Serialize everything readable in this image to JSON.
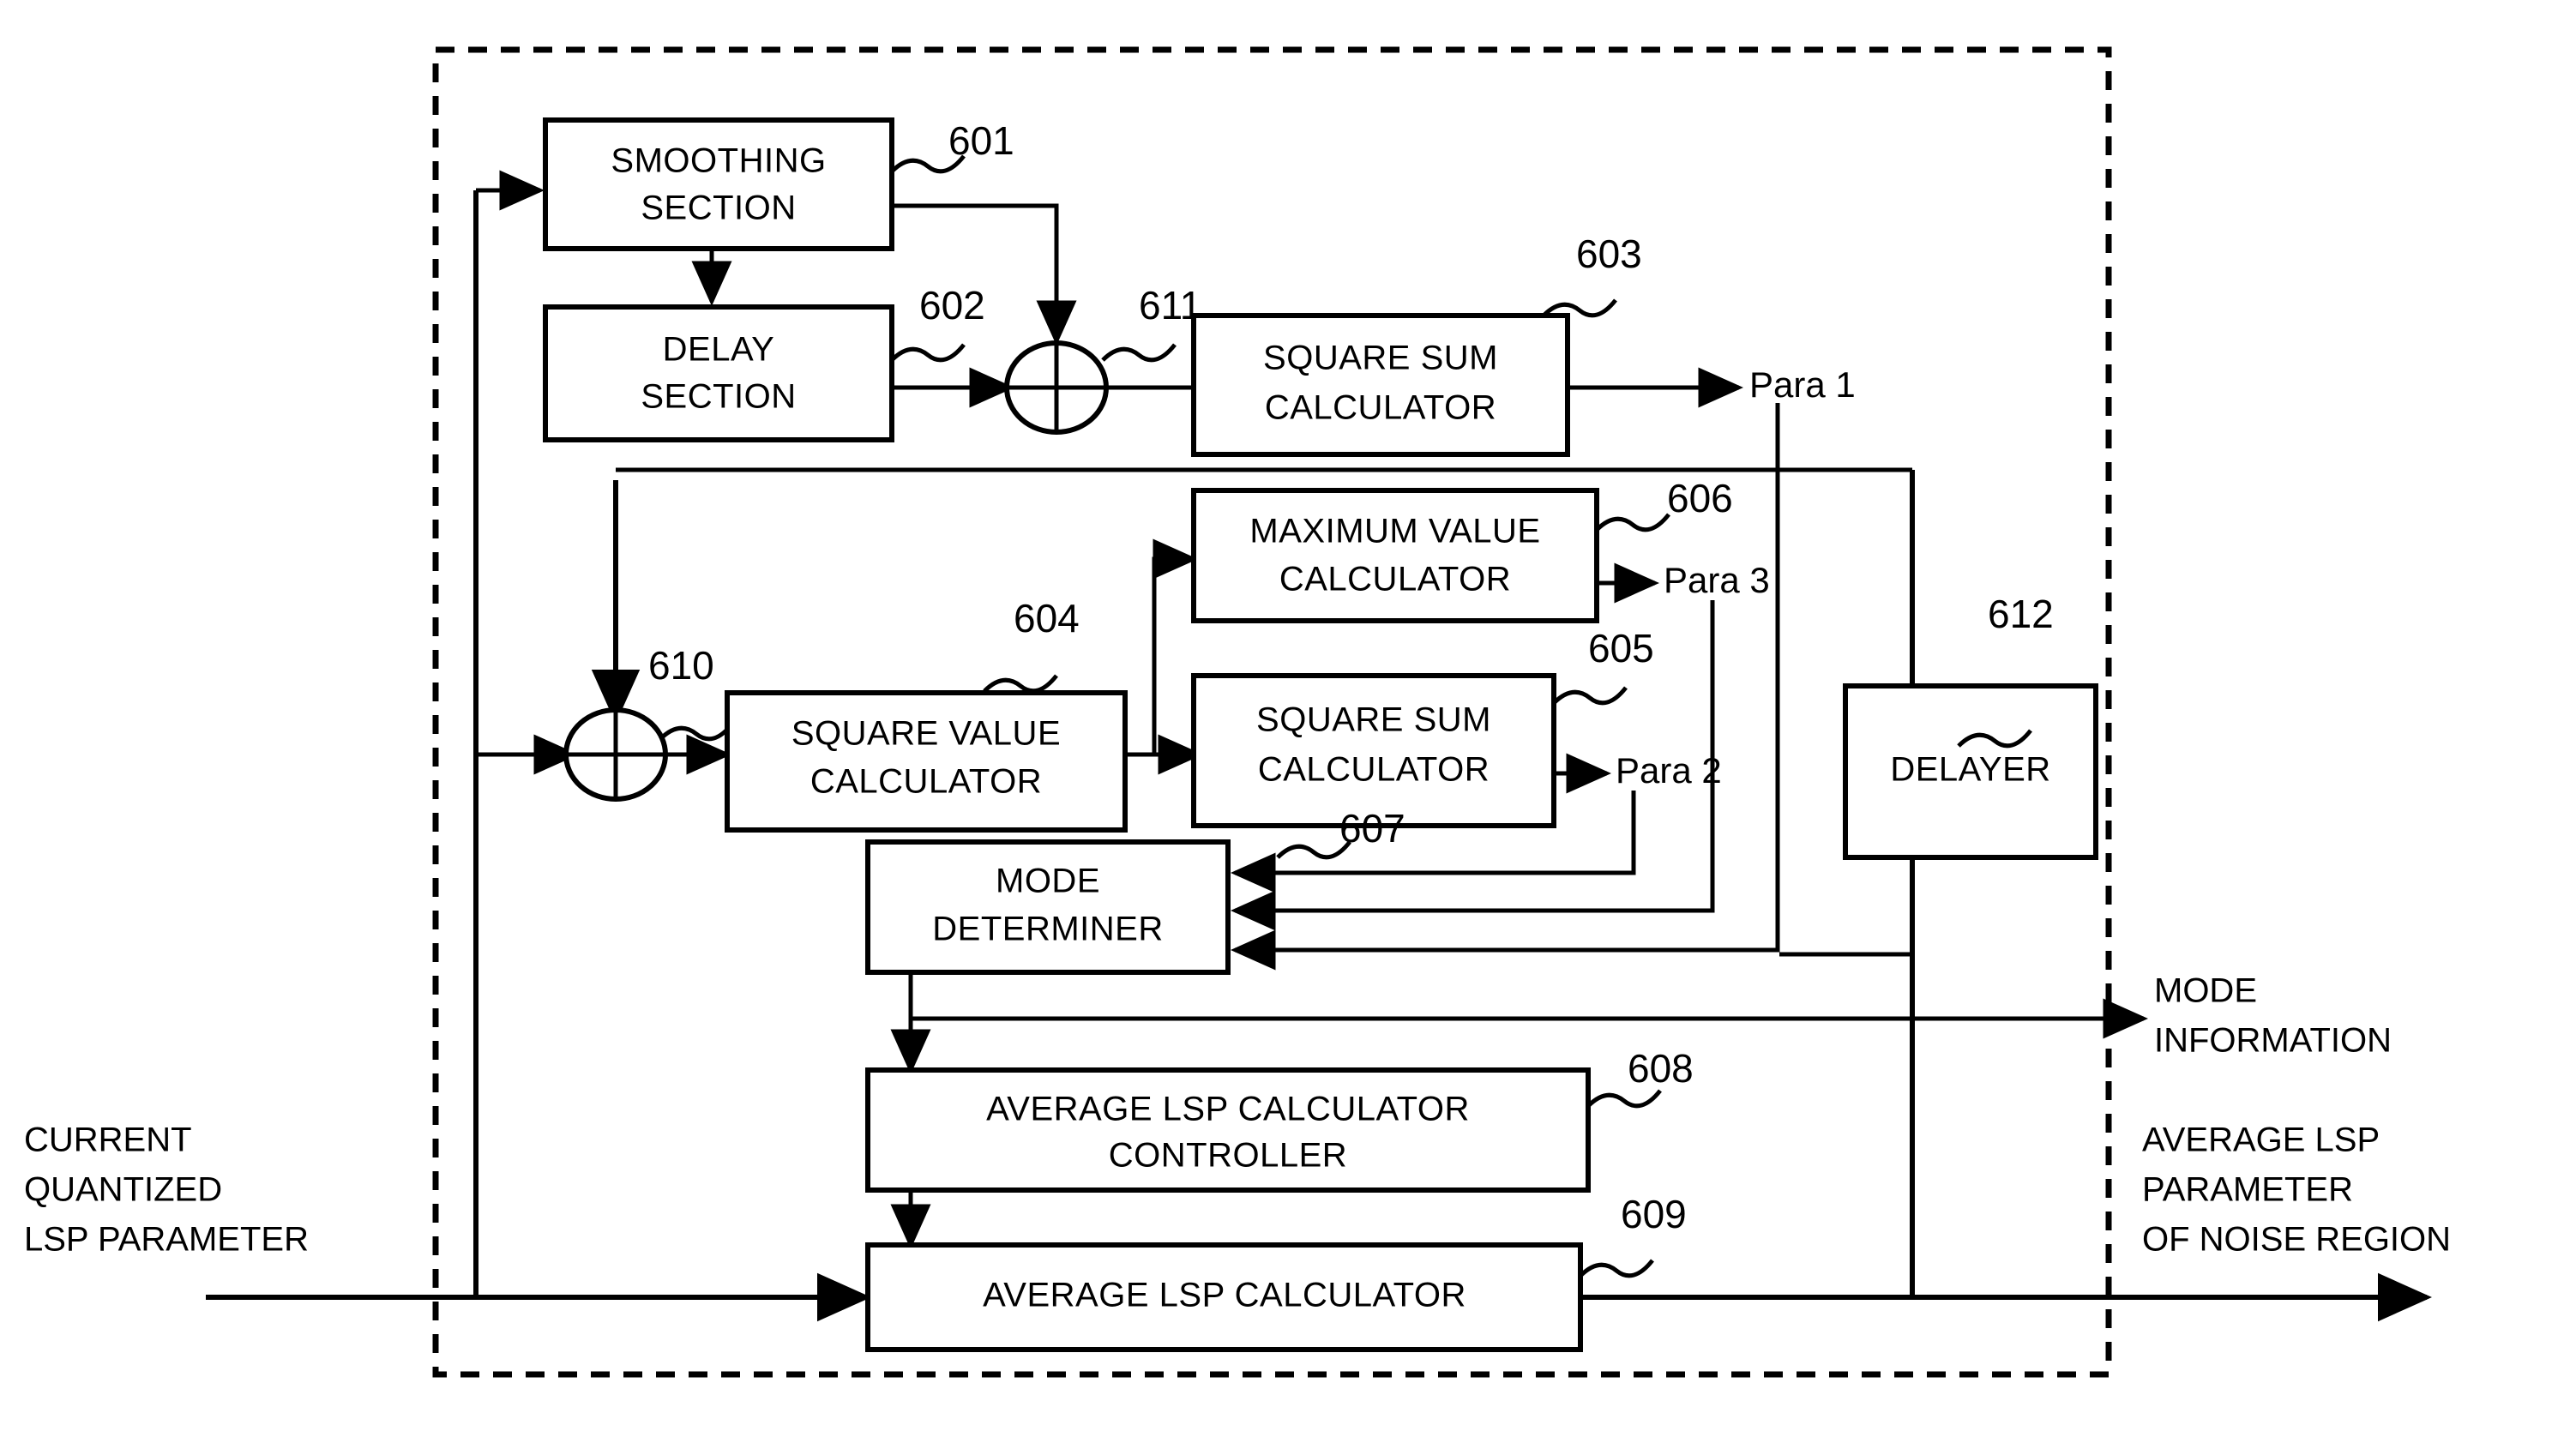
{
  "figure": {
    "type": "patent-block-diagram",
    "title": "LSP parameter mode determination block diagram"
  },
  "blocks": [
    {
      "id": "b601",
      "ref": "601",
      "lines": [
        "SMOOTHING",
        "SECTION"
      ]
    },
    {
      "id": "b602",
      "ref": "602",
      "lines": [
        "DELAY",
        "SECTION"
      ]
    },
    {
      "id": "b603",
      "ref": "603",
      "lines": [
        "SQUARE SUM",
        "CALCULATOR"
      ]
    },
    {
      "id": "b604",
      "ref": "604",
      "lines": [
        "SQUARE VALUE",
        "CALCULATOR"
      ]
    },
    {
      "id": "b605",
      "ref": "605",
      "lines": [
        "SQUARE SUM",
        "CALCULATOR"
      ]
    },
    {
      "id": "b606",
      "ref": "606",
      "lines": [
        "MAXIMUM VALUE",
        "CALCULATOR"
      ]
    },
    {
      "id": "b607",
      "ref": "607",
      "lines": [
        "MODE",
        "DETERMINER"
      ]
    },
    {
      "id": "b608",
      "ref": "608",
      "lines": [
        "AVERAGE LSP CALCULATOR",
        "CONTROLLER"
      ]
    },
    {
      "id": "b609",
      "ref": "609",
      "lines": [
        "AVERAGE LSP CALCULATOR"
      ]
    },
    {
      "id": "b612",
      "ref": "612",
      "lines": [
        "DELAYER"
      ]
    }
  ],
  "adders": [
    {
      "id": "a610",
      "ref": "610"
    },
    {
      "id": "a611",
      "ref": "611"
    }
  ],
  "signals": {
    "para1": "Para 1",
    "para2": "Para 2",
    "para3": "Para 3"
  },
  "io_labels": {
    "input": [
      "CURRENT",
      "QUANTIZED",
      "LSP PARAMETER"
    ],
    "output_mode": [
      "MODE",
      "INFORMATION"
    ],
    "output_avg": [
      "AVERAGE LSP",
      "PARAMETER",
      "OF NOISE REGION"
    ]
  },
  "colors": {
    "ink": "#000000",
    "paper": "#ffffff"
  }
}
